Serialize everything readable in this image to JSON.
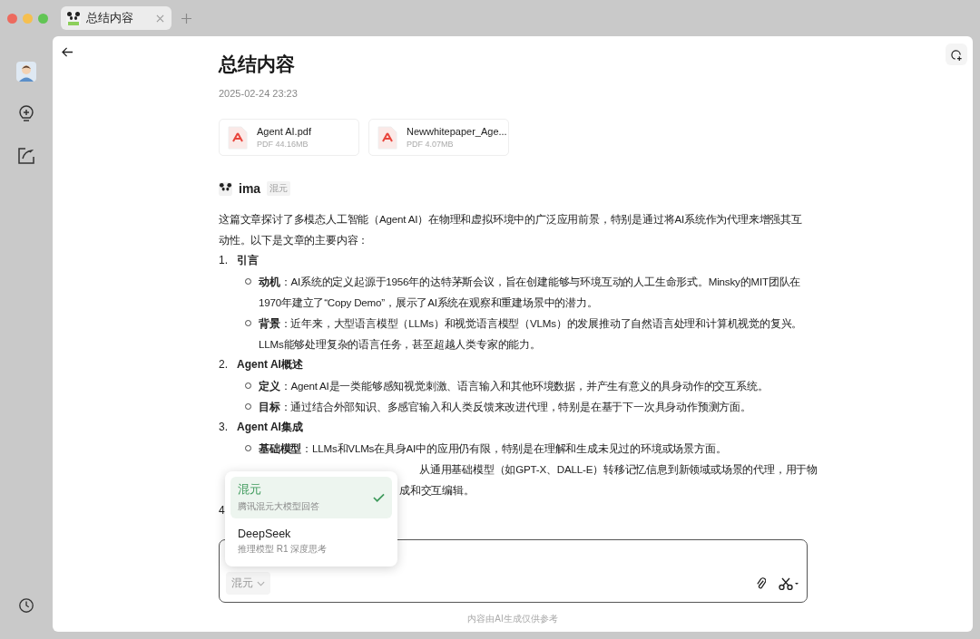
{
  "tabs": [
    {
      "label": "总结内容",
      "selected": true
    }
  ],
  "title": "总结内容",
  "date": "2025-02-24 23:23",
  "files": [
    {
      "name": "Agent AI.pdf",
      "meta": "PDF 44.16MB"
    },
    {
      "name": "Newwhitepaper_Age...",
      "meta": "PDF 4.07MB"
    }
  ],
  "assistant": {
    "name": "ima",
    "model_tag": "混元"
  },
  "intro": "这篇文章探讨了多模态人工智能（Agent AI）在物理和虚拟环境中的广泛应用前景，特别是通过将AI系统作为代理来增强其互动性。以下是文章的主要内容：",
  "sections": [
    {
      "number": "1.",
      "heading": "引言",
      "bullets": [
        "**动机**：AI系统的定义起源于1956年的达特茅斯会议，旨在创建能够与环境互动的人工生命形式。Minsky的MIT团队在1970年建立了“Copy Demo”，展示了AI系统在观察和重建场景中的潜力。",
        "**背景**：近年来，大型语言模型（LLMs）和视觉语言模型（VLMs）的发展推动了自然语言处理和计算机视觉的复兴。LLMs能够处理复杂的语言任务，甚至超越人类专家的能力。"
      ]
    },
    {
      "number": "2.",
      "heading": "Agent AI概述",
      "bullets": [
        "**定义**：Agent AI是一类能够感知视觉刺激、语言输入和其他环境数据，并产生有意义的具身动作的交互系统。",
        "**目标**：通过结合外部知识、多感官输入和人类反馈来改进代理，特别是在基于下一次具身动作预测方面。"
      ]
    },
    {
      "number": "3.",
      "heading": "Agent AI集成",
      "bullets": [
        "**基础模型**：LLMs和VLMs在具身AI中的应用仍有限，特别是在理解和生成未见过的环境或场景方面。"
      ],
      "covered_lines": [
        "从通用基础模型（如GPT-X、DALL-E）转移记忆信息到新领域或场景的代理，用于物",
        "成和交互编辑。"
      ]
    },
    {
      "number": "4"
    }
  ],
  "model_menu": [
    {
      "name": "混元",
      "description": "腾讯混元大模型回答",
      "selected": true
    },
    {
      "name": "DeepSeek",
      "description": "推理模型 R1 深度思考",
      "selected": false
    }
  ],
  "composer": {
    "model": "混元"
  },
  "footer": "内容由AI生成仅供参考"
}
